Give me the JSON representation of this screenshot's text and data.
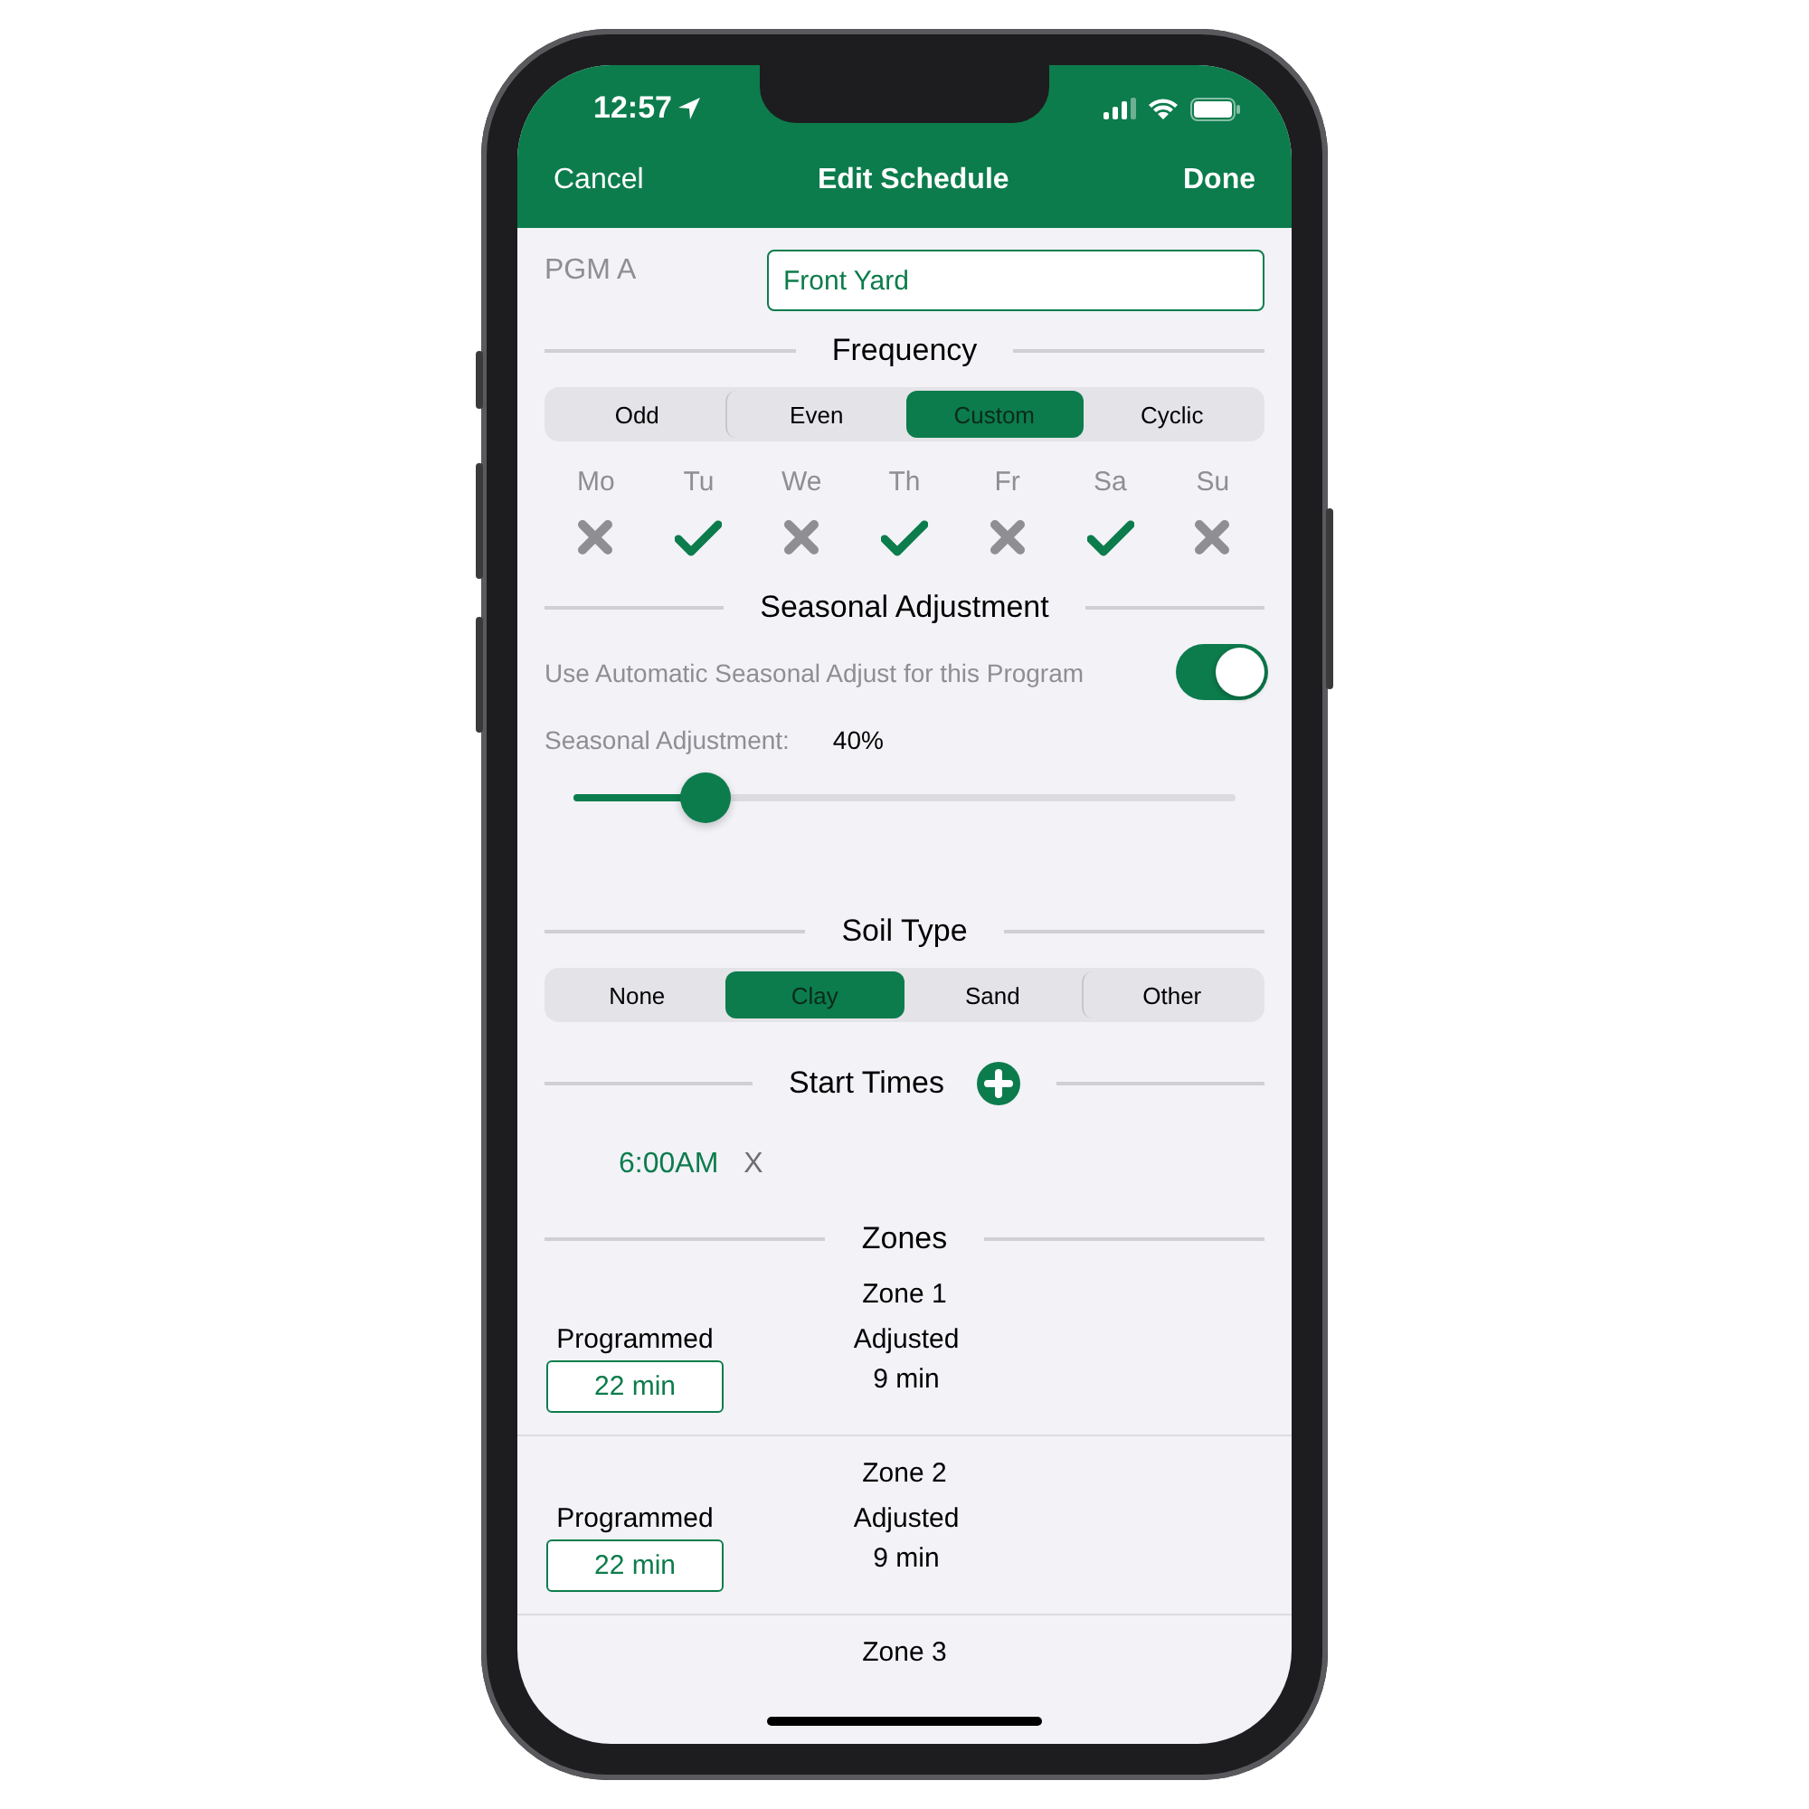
{
  "status_bar": {
    "time": "12:57"
  },
  "nav": {
    "left": "Cancel",
    "title": "Edit Schedule",
    "right": "Done"
  },
  "program": {
    "label": "PGM A",
    "value": "Front Yard"
  },
  "frequency": {
    "heading": "Frequency",
    "segments": [
      {
        "label": "Odd",
        "selected": false
      },
      {
        "label": "Even",
        "selected": false
      },
      {
        "label": "Custom",
        "selected": true
      },
      {
        "label": "Cyclic",
        "selected": false
      }
    ],
    "days": [
      {
        "label": "Mo",
        "checked": false
      },
      {
        "label": "Tu",
        "checked": true
      },
      {
        "label": "We",
        "checked": false
      },
      {
        "label": "Th",
        "checked": true
      },
      {
        "label": "Fr",
        "checked": false
      },
      {
        "label": "Sa",
        "checked": true
      },
      {
        "label": "Su",
        "checked": false
      }
    ]
  },
  "seasonal": {
    "heading": "Seasonal Adjustment",
    "toggle_label": "Use Automatic Seasonal Adjust for this Program",
    "on": true,
    "adjust_label": "Seasonal Adjustment:",
    "adjust_value": "40%",
    "level": 0.2
  },
  "soil": {
    "heading": "Soil Type",
    "segments": [
      {
        "label": "None",
        "selected": false
      },
      {
        "label": "Clay",
        "selected": true
      },
      {
        "label": "Sand",
        "selected": false
      },
      {
        "label": "Other",
        "selected": false
      }
    ]
  },
  "start_times": {
    "heading": "Start Times",
    "times": [
      {
        "time": "6:00AM",
        "remove": "X"
      }
    ]
  },
  "zones": {
    "heading": "Zones",
    "items": [
      {
        "title": "Zone 1",
        "programmed_label": "Programmed",
        "programmed": "22 min",
        "adjusted_label": "Adjusted",
        "adjusted": "9 min"
      },
      {
        "title": "Zone 2",
        "programmed_label": "Programmed",
        "programmed": "22 min",
        "adjusted_label": "Adjusted",
        "adjusted": "9 min"
      },
      {
        "title": "Zone 3"
      }
    ]
  }
}
